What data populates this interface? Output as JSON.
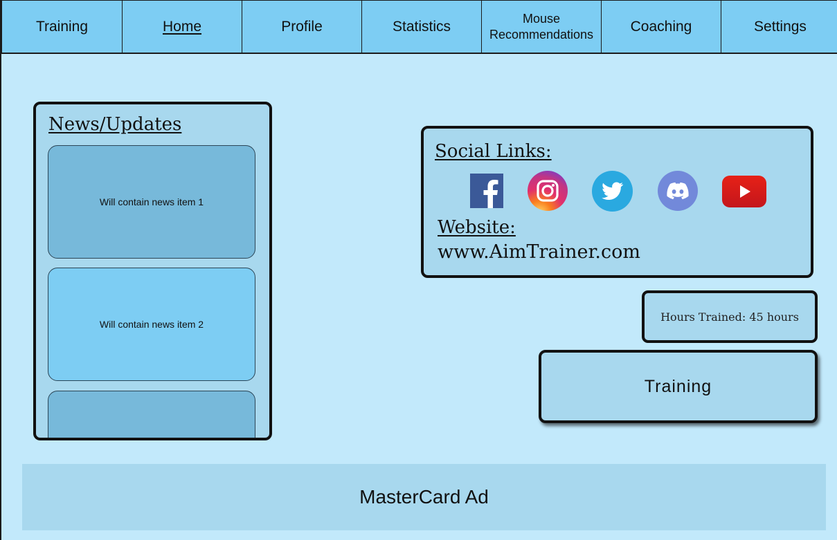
{
  "nav": {
    "items": [
      {
        "label": "Training",
        "active": false
      },
      {
        "label": "Home",
        "active": true
      },
      {
        "label": "Profile",
        "active": false
      },
      {
        "label": "Statistics",
        "active": false
      },
      {
        "label": "Mouse Recommendations",
        "active": false
      },
      {
        "label": "Coaching",
        "active": false
      },
      {
        "label": "Settings",
        "active": false
      }
    ]
  },
  "news": {
    "title": "News/Updates",
    "items": [
      {
        "text": "Will contain news item 1"
      },
      {
        "text": "Will contain news item 2"
      },
      {
        "text": ""
      }
    ]
  },
  "social": {
    "title": "Social Links:",
    "icons": [
      "facebook-icon",
      "instagram-icon",
      "twitter-icon",
      "discord-icon",
      "youtube-icon"
    ],
    "website_title": "Website:",
    "website_url": "www.AimTrainer.com"
  },
  "hours": {
    "text": "Hours Trained: 45 hours"
  },
  "training_button": {
    "label": "Training"
  },
  "ad": {
    "text": "MasterCard Ad"
  },
  "colors": {
    "background": "#c2e9fb",
    "nav": "#7dcdf3",
    "panel": "#a8d8ee",
    "news_item_dark": "#77b9da",
    "news_item_light": "#7dcdf3"
  }
}
